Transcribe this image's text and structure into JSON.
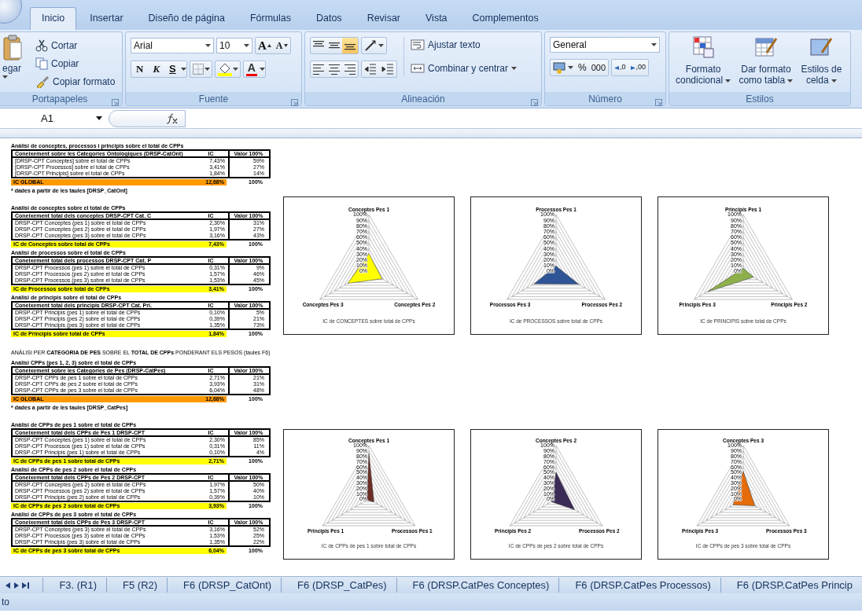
{
  "ribbon_tabs": [
    {
      "label": "Inicio",
      "selected": true
    },
    {
      "label": "Insertar",
      "selected": false
    },
    {
      "label": "Diseño de página",
      "selected": false
    },
    {
      "label": "Fórmulas",
      "selected": false
    },
    {
      "label": "Datos",
      "selected": false
    },
    {
      "label": "Revisar",
      "selected": false
    },
    {
      "label": "Vista",
      "selected": false
    },
    {
      "label": "Complementos",
      "selected": false
    }
  ],
  "clipboard": {
    "title": "Portapapeles",
    "paste": "egar",
    "cut": "Cortar",
    "copy": "Copiar",
    "format_painter": "Copiar formato"
  },
  "font": {
    "title": "Fuente",
    "font_name": "Arial",
    "font_size": "10",
    "grow": "A",
    "shrink": "A",
    "bold": "N",
    "italic": "K",
    "underline": "S",
    "font_color": "A"
  },
  "alignment": {
    "title": "Alineación",
    "vertical": [
      {
        "selected": false
      },
      {
        "selected": false
      },
      {
        "selected": true
      }
    ],
    "horizontal": [
      {
        "selected": false
      },
      {
        "selected": false
      },
      {
        "selected": false
      }
    ],
    "wrap_text": "Ajustar texto",
    "merge_center": "Combinar y centrar"
  },
  "number": {
    "title": "Número",
    "format": "General",
    "percent": "%",
    "thousands": "000",
    "increase_decimal": ",0",
    "decrease_decimal": ",00"
  },
  "styles": {
    "title": "Estilos",
    "buttons": [
      [
        "Formato",
        "condicional"
      ],
      [
        "Dar formato",
        "como tabla"
      ],
      [
        "Estilos de",
        "celda"
      ]
    ]
  },
  "formula_bar": {
    "name_box": "A1"
  },
  "sections": [
    {
      "tables": [
        {
          "caption": "Anàlisi de conceptes, processos i principis sobre el total de CPPs",
          "header": [
            "Coneixement sobre les Categories Ontològiques (DRSP-CatOnt)",
            "IC",
            "Valor 100%"
          ],
          "rows": [
            [
              "[DRSP-CPT Conceptes] sobre el total de CPPs",
              "7,43%",
              "59%"
            ],
            [
              "[DRSP-CPT Processos] sobre el total de CPPs",
              "3,41%",
              "27%"
            ],
            [
              "[DRSP-CPT Principis] sobre el total de CPPs",
              "1,84%",
              "14%"
            ]
          ],
          "total": [
            "IC GLOBAL",
            "12,68%",
            "100%"
          ],
          "color": "#ff9900",
          "note": "* dades a partir de les taules [DRSP_CatOnt]"
        },
        {
          "caption": "Anàlisi de conceptes sobre el total de CPPs",
          "header": [
            "Coneixement total dels conceptes DRSP-CPT Cat. C",
            "IC",
            "Valor 100%"
          ],
          "rows": [
            [
              "DRSP-CPT Conceptes (pes 1) sobre el total de CPPs",
              "2,30%",
              "31%"
            ],
            [
              "DRSP-CPT Conceptes (pes 2) sobre el total de CPPs",
              "1,97%",
              "27%"
            ],
            [
              "DRSP-CPT Conceptes (pes 3) sobre el total de CPPs",
              "3,16%",
              "43%"
            ]
          ],
          "total": [
            "IC de Conceptes sobre total de CPPs",
            "7,43%",
            "100%"
          ],
          "color": "#ffff00"
        },
        {
          "caption": "Anàlisi de processos sobre el total de CPPs",
          "header": [
            "Coneixement total dels processos DRSP-CPT Cat. P",
            "IC",
            "Valor 100%"
          ],
          "rows": [
            [
              "DRSP-CPT Processos (pes 1) sobre el total de CPPs",
              "0,31%",
              "9%"
            ],
            [
              "DRSP-CPT Processos (pes 2) sobre el total de CPPs",
              "1,57%",
              "46%"
            ],
            [
              "DRSP-CPT Processos (pes 3) sobre el total de CPPs",
              "1,53%",
              "45%"
            ]
          ],
          "total": [
            "IC de Processos sobre total de CPPs",
            "3,41%",
            "100%"
          ],
          "color": "#ffff00"
        },
        {
          "caption": "Anàlisi de principis sobre el total de CPPs",
          "header": [
            "Coneixement total dels principis DRSP-CPT Cat. Pri.",
            "IC",
            "Valor 100%"
          ],
          "rows": [
            [
              "DRSP-CPT Principis (pes 1) sobre el total de CPPs",
              "0,10%",
              "5%"
            ],
            [
              "DRSP-CPT Principis (pes 2) sobre el total de CPPs",
              "0,39%",
              "21%"
            ],
            [
              "DRSP-CPT Principis (pes 3) sobre el total de CPPs",
              "1,35%",
              "73%"
            ]
          ],
          "total": [
            "IC de Principis sobre total de CPPs",
            "1,84%",
            "100%"
          ],
          "color": "#ffff00"
        }
      ],
      "charts": [
        {
          "title": "IC de CONCEPTES sobre total de CPPs",
          "color": "#ffff00",
          "tick_labels": [
            "100%",
            "90%",
            "80%",
            "70%",
            "60%",
            "50%",
            "40%",
            "30%",
            "20%",
            "10%",
            "0%"
          ],
          "axes": [
            {
              "label": "Conceptes Pes 1"
            },
            {
              "label": "Conceptes Pes 3"
            },
            {
              "label": "Conceptes Pes 2"
            }
          ]
        },
        {
          "title": "IC de PROCESSOS sobre total de CPPs",
          "color": "#2f5597",
          "tick_labels": [
            "100%",
            "90%",
            "80%",
            "70%",
            "60%",
            "50%",
            "40%",
            "30%",
            "20%",
            "10%",
            "0%"
          ],
          "axes": [
            {
              "label": "Processos Pes 1"
            },
            {
              "label": "Processos Pes 3"
            },
            {
              "label": "Processos Pes 2"
            }
          ]
        },
        {
          "title": "IC de PRINCIPIS sobre total de CPPs",
          "color": "#8db04a",
          "tick_labels": [
            "100%",
            "90%",
            "80%",
            "70%",
            "60%",
            "50%",
            "40%",
            "30%",
            "20%",
            "10%",
            "0%"
          ],
          "axes": [
            {
              "label": "Principis Pes 1"
            },
            {
              "label": "Principis Pes 3"
            },
            {
              "label": "Principis Pes 2"
            }
          ]
        }
      ]
    },
    {
      "heading": "ANÀLISI PER **CATEGORIA DE PES** SOBRE EL **TOTAL DE CPPs** PONDERANT ELS PESOS (taules F6)",
      "tables": [
        {
          "caption": "Anàlisi CPPs (pes 1, 2, 3) sobre el total de CPPs",
          "header": [
            "Coneixement sobre les Categories de Pes (DRSP-CatPes)",
            "IC",
            "Valor 100%"
          ],
          "rows": [
            [
              "DRSP-CPT CPPs de pes 1 sobre el total de CPPs",
              "2,71%",
              "21%"
            ],
            [
              "DRSP-CPT CPPs de pes 2 sobre el total de CPPs",
              "3,93%",
              "31%"
            ],
            [
              "DRSP-CPT CPPs de pes 3 sobre el total de CPPs",
              "6,04%",
              "48%"
            ]
          ],
          "total": [
            "IC GLOBAL",
            "12,68%",
            "100%"
          ],
          "color": "#ff9900",
          "note": "* dades a partir de les taules [DRSP_CatPes]"
        },
        {
          "caption": "Anàlisi de CPPs de pes 1 sobre el total de CPPs",
          "header": [
            "Coneixement total dels CPPs de Pes 1 DRSP-CPT",
            "IC",
            "Valor 100%"
          ],
          "rows": [
            [
              "DRSP-CPT Conceptes (pes 1) sobre el total de CPPs",
              "2,30%",
              "85%"
            ],
            [
              "DRSP-CPT Processos (pes 1) sobre el total de CPPs",
              "0,31%",
              "11%"
            ],
            [
              "DRSP-CPT Principis (pes 1) sobre el total de CPPs",
              "0,10%",
              "4%"
            ]
          ],
          "total": [
            "IC de CPPs de pes 1 sobre total de CPPs",
            "2,71%",
            "100%"
          ],
          "color": "#ffff00"
        },
        {
          "caption": "Anàlisi de CPPs de pes 2 sobre el total de CPPs",
          "header": [
            "Coneixement total dels CPPs de Pes 2 DRSP-CPT",
            "IC",
            "Valor 100%"
          ],
          "rows": [
            [
              "DRSP-CPT Conceptes (pes 2) sobre el total de CPPs",
              "1,97%",
              "50%"
            ],
            [
              "DRSP-CPT Processos (pes 2) sobre el total de CPPs",
              "1,57%",
              "40%"
            ],
            [
              "DRSP-CPT Principis (pes 2) sobre el total de CPPs",
              "0,39%",
              "10%"
            ]
          ],
          "total": [
            "IC de CPPs de pes 2 sobre total de CPPs",
            "3,93%",
            "100%"
          ],
          "color": "#ffff00"
        },
        {
          "caption": "Anàlisi de CPPs de pes 3 sobre el total de CPPs",
          "header": [
            "Coneixement total dels CPPs de Pes 3 DRSP-CPT",
            "IC",
            "Valor 100%"
          ],
          "rows": [
            [
              "DRSP-CPT Conceptes (pes 3) sobre el total de CPPs",
              "3,16%",
              "52%"
            ],
            [
              "DRSP-CPT Processos (pes 3) sobre el total de CPPs",
              "1,53%",
              "25%"
            ],
            [
              "DRSP-CPT Principis (pes 3) sobre el total de CPPs",
              "1,35%",
              "22%"
            ]
          ],
          "total": [
            "IC de CPPs de pes 3 sobre total de CPPs",
            "6,04%",
            "100%"
          ],
          "color": "#ffff00"
        }
      ],
      "charts": [
        {
          "title": "IC de CPPs de pes 1 sobre total de CPPs",
          "color": "#6b2d24",
          "tick_labels": [
            "100%",
            "90%",
            "80%",
            "70%",
            "60%",
            "50%",
            "40%",
            "30%",
            "20%",
            "10%",
            "0%"
          ],
          "axes": [
            {
              "label": "Conceptes Pes 1"
            },
            {
              "label": "Principis Pes 1"
            },
            {
              "label": "Processos Pes 1"
            }
          ]
        },
        {
          "title": "IC de CPPs de pes 2 sobre total de CPPs",
          "color": "#3b2b57",
          "tick_labels": [
            "100%",
            "90%",
            "80%",
            "70%",
            "60%",
            "50%",
            "40%",
            "30%",
            "20%",
            "10%",
            "0%"
          ],
          "axes": [
            {
              "label": "Conceptes Pes 2"
            },
            {
              "label": "Principis Pes 2"
            },
            {
              "label": "Processos Pes 2"
            }
          ]
        },
        {
          "title": "IC de CPPs de pes 3 sobre total de CPPs",
          "color": "#e46c0a",
          "tick_labels": [
            "100%",
            "90%",
            "80%",
            "70%",
            "60%",
            "50%",
            "40%",
            "30%",
            "20%",
            "10%",
            "0%"
          ],
          "axes": [
            {
              "label": "Conceptes Pes 3"
            },
            {
              "label": "Principis Pes 3"
            },
            {
              "label": "Processos Pes 3"
            }
          ]
        }
      ]
    }
  ],
  "sheet_tabs": [
    "F3. (R1)",
    "F5 (R2)",
    "F6 (DRSP_CatOnt)",
    "F6 (DRSP_CatPes)",
    "F6 (DRSP.CatPes Conceptes)",
    "F6 (DRSP.CatPes Processos)",
    "F6 (DRSP.CatPes Princip"
  ],
  "status_bar": "to"
}
